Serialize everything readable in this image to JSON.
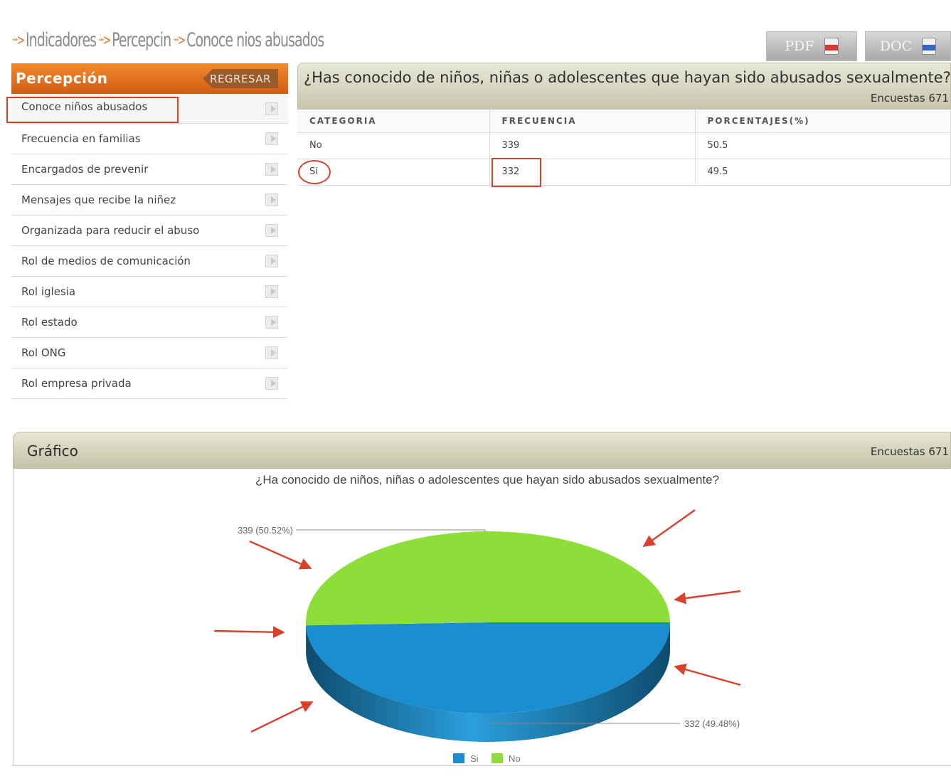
{
  "breadcrumb": {
    "items": [
      "Indicadores",
      "Percepcin",
      "Conoce nios abusados"
    ]
  },
  "export": {
    "pdf_label": "PDF",
    "doc_label": "DOC",
    "pdf_icon": "pdf-file-icon",
    "doc_icon": "doc-file-icon"
  },
  "sidebar": {
    "title": "Percepción",
    "back_label": "REGRESAR",
    "items": [
      {
        "label": "Conoce niños abusados"
      },
      {
        "label": "Frecuencia en familias"
      },
      {
        "label": "Encargados de prevenir"
      },
      {
        "label": "Mensajes que recibe la niñez"
      },
      {
        "label": "Organizada para reducir el abuso"
      },
      {
        "label": "Rol de medios de comunicación"
      },
      {
        "label": "Rol iglesia"
      },
      {
        "label": "Rol estado"
      },
      {
        "label": "Rol ONG"
      },
      {
        "label": "Rol empresa privada"
      }
    ]
  },
  "question": {
    "title": "¿Has conocido de niños, niñas o adolescentes que hayan sido abusados sexualmente?",
    "surveys": "Encuestas 671"
  },
  "table": {
    "headers": [
      "CATEGORIA",
      "FRECUENCIA",
      "PORCENTAJES(%)"
    ],
    "rows": [
      [
        "No",
        "339",
        "50.5"
      ],
      [
        "Si",
        "332",
        "49.5"
      ]
    ]
  },
  "chart_panel": {
    "title": "Gráfico",
    "surveys": "Encuestas 671"
  },
  "colors": {
    "orange": "#e8731f",
    "si_blue": "#1b8ed1",
    "no_green": "#8ede39",
    "annotation_red": "#d9412b"
  },
  "chart_data": {
    "type": "pie",
    "title": "¿Ha conocido de niños, niñas o adolescentes que hayan sido abusados sexualmente?",
    "categories": [
      "Si",
      "No"
    ],
    "values": [
      332,
      339
    ],
    "data_labels": [
      "332 (49.48%)",
      "339 (50.52%)"
    ],
    "legend": [
      "Si",
      "No"
    ],
    "legend_position": "bottom",
    "three_d": true
  }
}
